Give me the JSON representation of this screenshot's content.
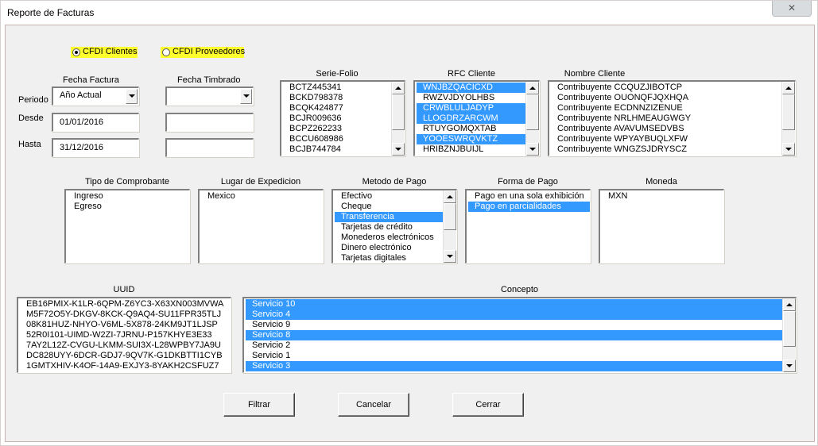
{
  "window": {
    "title": "Reporte de Facturas",
    "close_glyph": "✕"
  },
  "radios": {
    "clientes": {
      "label": "CFDI Clientes",
      "selected": true
    },
    "proveedores": {
      "label": "CFDI Proveedores",
      "selected": false
    }
  },
  "fecha_factura": {
    "heading": "Fecha Factura",
    "periodo": "Año Actual",
    "desde": "01/01/2016",
    "hasta": "31/12/2016"
  },
  "fecha_timbrado": {
    "heading": "Fecha Timbrado",
    "periodo": "",
    "desde": "",
    "hasta": ""
  },
  "labels": {
    "periodo": "Periodo",
    "desde": "Desde",
    "hasta": "Hasta"
  },
  "serie_folio": {
    "heading": "Serie-Folio",
    "items": [
      "BCTZ445341",
      "BCKD798378",
      "BCQK424877",
      "BCJR009636",
      "BCPZ262233",
      "BCCU608986",
      "BCJB744784"
    ]
  },
  "rfc_cliente": {
    "heading": "RFC Cliente",
    "items": [
      "WNJBZQACICXD",
      "RWZVJDYOLHBS",
      "CRWBLULJADYP",
      "LLOGDRZARCWM",
      "RTUYGOMQXTAB",
      "YOOESWRQVKTZ",
      "HRIBZNJBUIJL"
    ],
    "selected": [
      0,
      2,
      3,
      5
    ]
  },
  "nombre_cliente": {
    "heading": "Nombre Cliente",
    "items": [
      "Contribuyente CCQUZJIBOTCP",
      "Contribuyente OUONQFJQXHQA",
      "Contribuyente ECDNNZIZENUE",
      "Contribuyente NRLHMEAUGWGY",
      "Contribuyente AVAVUMSEDVBS",
      "Contribuyente WPYAYBUQLXFW",
      "Contribuyente WNGZSJDRYSCZ"
    ]
  },
  "tipo_comprobante": {
    "heading": "Tipo de Comprobante",
    "items": [
      "Ingreso",
      "Egreso"
    ]
  },
  "lugar_expedicion": {
    "heading": "Lugar de Expedicion",
    "items": [
      "Mexico"
    ]
  },
  "metodo_pago": {
    "heading": "Metodo de Pago",
    "items": [
      "Efectivo",
      "Cheque",
      "Transferencia",
      "Tarjetas de crédito",
      "Monederos electrónicos",
      "Dinero electrónico",
      "Tarjetas digitales"
    ],
    "selected": [
      2
    ]
  },
  "forma_pago": {
    "heading": "Forma de Pago",
    "items": [
      "Pago en una sola exhibición",
      "Pago en parcialidades"
    ],
    "selected": [
      1
    ]
  },
  "moneda": {
    "heading": "Moneda",
    "items": [
      "MXN"
    ]
  },
  "uuid": {
    "heading": "UUID",
    "items": [
      "EB16PMIX-K1LR-6QPM-Z6YC3-X63XN003MVWA",
      "M5F72O5Y-DKGV-8KCK-Q9AQ4-SU11FPR35TLJ",
      "08K81HUZ-NHYO-V6ML-5X878-24KM9JT1LJSP",
      "52R0I101-UIMD-W2ZI-7JRNU-P157KHYE3E33",
      "7AY2L12Z-CVGU-LKMM-SUI3X-L28WPBY7JA9U",
      "DC828UYY-6DCR-GDJ7-9QV7K-G1DKBTTI1CYB",
      "1GMTXHIV-K4OF-14A9-EXJY3-8YAKH2CSFUZ7"
    ]
  },
  "concepto": {
    "heading": "Concepto",
    "items": [
      "Servicio 10",
      "Servicio 4",
      "Servicio 9",
      "Servicio 8",
      "Servicio 2",
      "Servicio 1",
      "Servicio 3"
    ],
    "selected": [
      0,
      1,
      3,
      6
    ]
  },
  "buttons": {
    "filtrar": "Filtrar",
    "cancelar": "Cancelar",
    "cerrar": "Cerrar"
  },
  "colors": {
    "selection": "#3399ff",
    "highlight": "#ffff2e",
    "face": "#f0f0f0"
  }
}
